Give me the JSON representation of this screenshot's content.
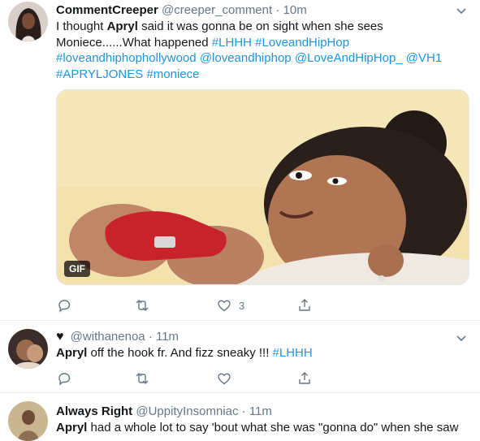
{
  "tweets": [
    {
      "name": "CommentCreeper",
      "handle": "@creeper_comment",
      "sep": "·",
      "time": "10m",
      "text": {
        "p1": "I thought ",
        "b1": "Apryl",
        "p2": " said it was gonna be on sight when she sees Moniece......What happened ",
        "l1": "#LHHH",
        "l2": "#LoveandHipHop",
        "l3": "#loveandhiphophollywood",
        "l4": "@loveandhiphop",
        "l5": "@LoveAndHipHop_",
        "l6": "@VH1",
        "l7": "#APRYLJONES",
        "l8": "#moniece"
      },
      "media_badge": "GIF",
      "like_count": "3"
    },
    {
      "name_icon": "♥",
      "handle": "@withanenoa",
      "sep": "·",
      "time": "11m",
      "text": {
        "b1": "Apryl",
        "p1": " off the hook fr. And fizz sneaky !!! ",
        "l1": "#LHHH"
      }
    },
    {
      "name": "Always Right",
      "handle": "@UppityInsomniac",
      "sep": "·",
      "time": "11m",
      "text": {
        "b1": "Apryl",
        "p1": " had a whole lot to say 'bout what she was \"gonna do\" when she saw"
      }
    }
  ],
  "colors": {
    "link": "#1b95e0",
    "muted": "#657786",
    "border": "#e6ecf0"
  },
  "icons": [
    "chevron-down-icon",
    "reply-icon",
    "retweet-icon",
    "like-icon",
    "share-icon"
  ]
}
